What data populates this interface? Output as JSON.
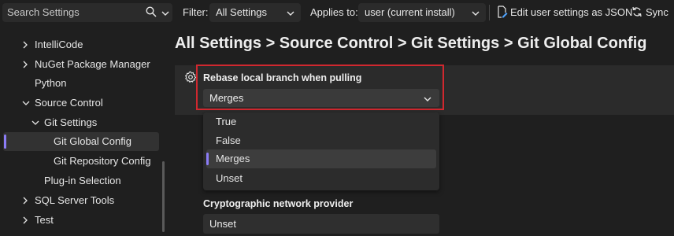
{
  "toolbar": {
    "search_placeholder": "Search Settings",
    "filter_label": "Filter:",
    "filter_value": "All Settings",
    "applies_label": "Applies to:",
    "applies_value": "user (current install)",
    "edit_json_label": "Edit user settings as JSON",
    "sync_label": "Sync"
  },
  "sidebar": {
    "items": [
      {
        "label": "IntelliCode"
      },
      {
        "label": "NuGet Package Manager"
      },
      {
        "label": "Python"
      },
      {
        "label": "Source Control"
      },
      {
        "label": "Git Settings"
      },
      {
        "label": "Git Global Config"
      },
      {
        "label": "Git Repository Config"
      },
      {
        "label": "Plug-in Selection"
      },
      {
        "label": "SQL Server Tools"
      },
      {
        "label": "Test"
      }
    ]
  },
  "main": {
    "breadcrumb": "All Settings > Source Control > Git Settings > Git Global Config",
    "setting1": {
      "title": "Rebase local branch when pulling",
      "value": "Merges",
      "options": [
        "True",
        "False",
        "Merges",
        "Unset"
      ],
      "selected": "Merges"
    },
    "setting2": {
      "title": "Cryptographic network provider",
      "value": "Unset"
    }
  },
  "colors": {
    "accent": "#8b7cf6",
    "highlight": "#d0282f",
    "background": "#1f1f1f"
  }
}
